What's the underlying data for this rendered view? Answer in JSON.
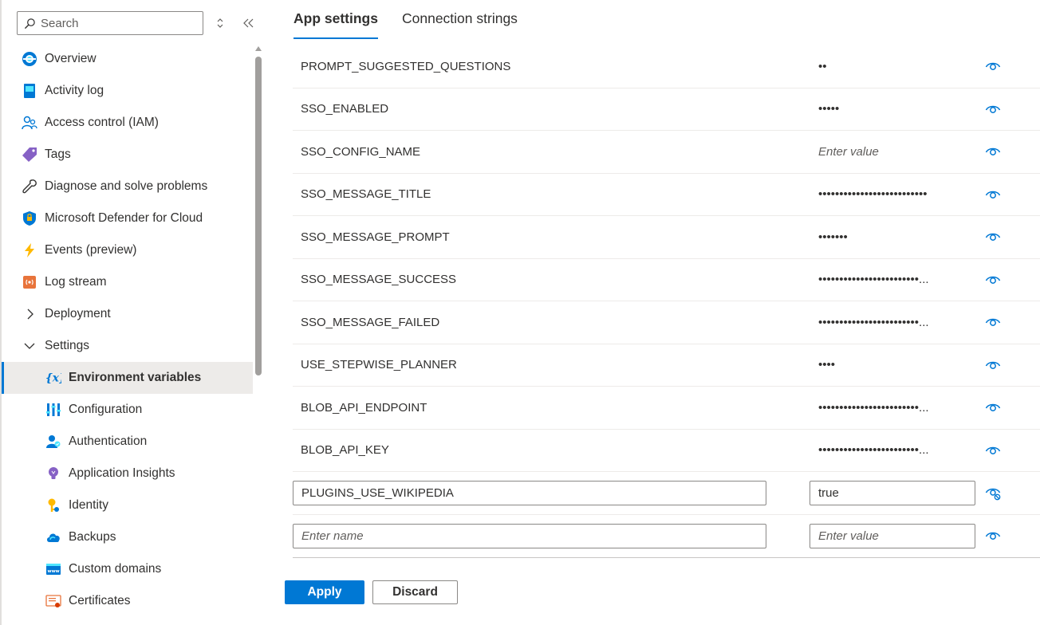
{
  "sidebar": {
    "search_placeholder": "Search",
    "items": [
      {
        "label": "Overview",
        "icon": "overview-icon"
      },
      {
        "label": "Activity log",
        "icon": "activity-log-icon"
      },
      {
        "label": "Access control (IAM)",
        "icon": "people-icon"
      },
      {
        "label": "Tags",
        "icon": "tag-icon"
      },
      {
        "label": "Diagnose and solve problems",
        "icon": "wrench-icon"
      },
      {
        "label": "Microsoft Defender for Cloud",
        "icon": "shield-icon"
      },
      {
        "label": "Events (preview)",
        "icon": "lightning-icon"
      },
      {
        "label": "Log stream",
        "icon": "log-stream-icon"
      },
      {
        "label": "Deployment",
        "icon": "chevron-right-icon"
      },
      {
        "label": "Settings",
        "icon": "chevron-down-icon"
      }
    ],
    "subitems": [
      {
        "label": "Environment variables",
        "icon": "variable-icon",
        "active": true
      },
      {
        "label": "Configuration",
        "icon": "configuration-icon"
      },
      {
        "label": "Authentication",
        "icon": "authentication-icon"
      },
      {
        "label": "Application Insights",
        "icon": "lightbulb-icon"
      },
      {
        "label": "Identity",
        "icon": "key-icon"
      },
      {
        "label": "Backups",
        "icon": "cloud-backup-icon"
      },
      {
        "label": "Custom domains",
        "icon": "www-icon"
      },
      {
        "label": "Certificates",
        "icon": "certificate-icon"
      }
    ]
  },
  "tabs": [
    {
      "label": "App settings",
      "active": true
    },
    {
      "label": "Connection strings",
      "active": false
    }
  ],
  "settings": [
    {
      "name": "PROMPT_SUGGESTED_QUESTIONS",
      "value": "••",
      "placeholder": false
    },
    {
      "name": "SSO_ENABLED",
      "value": "•••••",
      "placeholder": false
    },
    {
      "name": "SSO_CONFIG_NAME",
      "value": "Enter value",
      "placeholder": true
    },
    {
      "name": "SSO_MESSAGE_TITLE",
      "value": "••••••••••••••••••••••••••",
      "placeholder": false
    },
    {
      "name": "SSO_MESSAGE_PROMPT",
      "value": "•••••••",
      "placeholder": false
    },
    {
      "name": "SSO_MESSAGE_SUCCESS",
      "value": "••••••••••••••••••••••••...",
      "placeholder": false
    },
    {
      "name": "SSO_MESSAGE_FAILED",
      "value": "••••••••••••••••••••••••...",
      "placeholder": false
    },
    {
      "name": "USE_STEPWISE_PLANNER",
      "value": "••••",
      "placeholder": false
    },
    {
      "name": "BLOB_API_ENDPOINT",
      "value": "••••••••••••••••••••••••...",
      "placeholder": false
    },
    {
      "name": "BLOB_API_KEY",
      "value": "••••••••••••••••••••••••...",
      "placeholder": false
    }
  ],
  "edit_row": {
    "name": "PLUGINS_USE_WIKIPEDIA",
    "value": "true"
  },
  "new_row": {
    "name_placeholder": "Enter name",
    "value_placeholder": "Enter value"
  },
  "buttons": {
    "apply": "Apply",
    "discard": "Discard"
  },
  "colors": {
    "accent": "#0078d4",
    "text": "#323130",
    "border": "#8a8886",
    "active_bg": "#edebe9"
  }
}
